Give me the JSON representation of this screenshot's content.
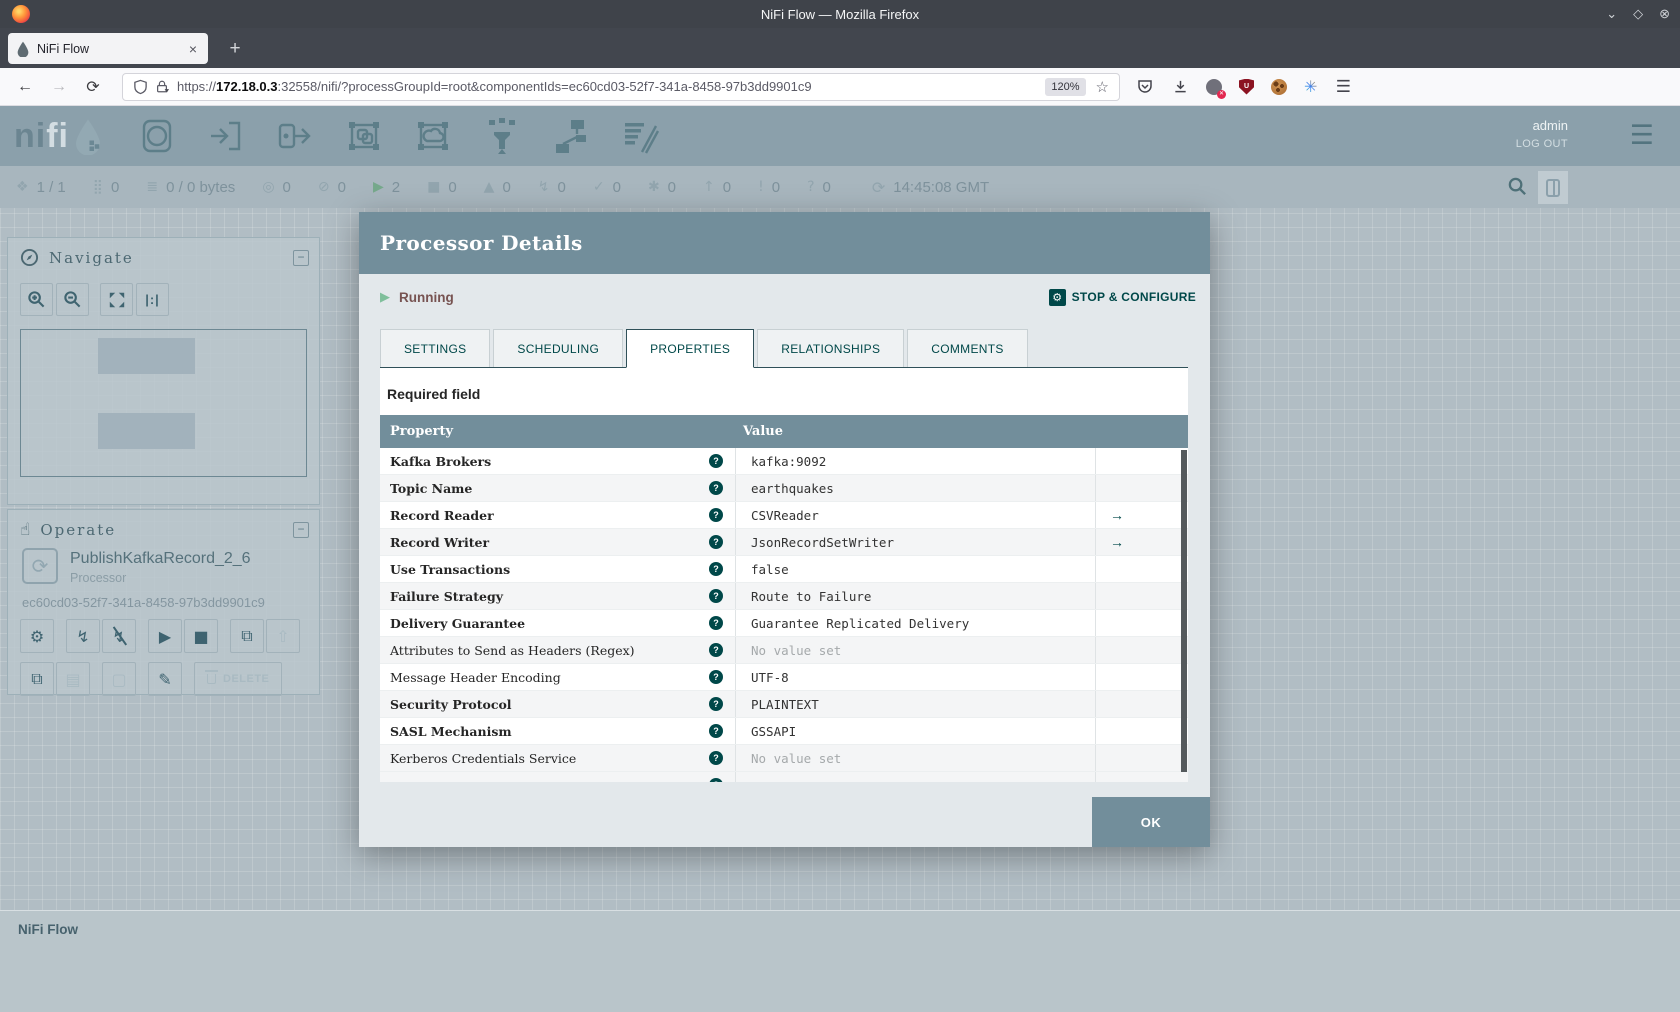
{
  "browser": {
    "window_title": "NiFi Flow — Mozilla Firefox",
    "tab_title": "NiFi Flow",
    "close_tab_label": "×",
    "new_tab_label": "+",
    "url_scheme": "https://",
    "url_host": "172.18.0.3",
    "url_rest": ":32558/nifi/?processGroupId=root&componentIds=ec60cd03-52f7-341a-8458-97b3dd9901c9",
    "zoom_badge": "120%"
  },
  "nifi": {
    "logo_text_left": "ni",
    "logo_text_right": "fi",
    "user": "admin",
    "logout_label": "LOG OUT",
    "status_bar": {
      "items": [
        {
          "icon": "clustered-nodes",
          "value": "1 / 1"
        },
        {
          "icon": "active-threads",
          "value": "0"
        },
        {
          "icon": "queued",
          "value": "0 / 0 bytes"
        },
        {
          "icon": "transmitting",
          "value": "0"
        },
        {
          "icon": "not-transmitting",
          "value": "0"
        },
        {
          "icon": "running",
          "value": "2"
        },
        {
          "icon": "stopped",
          "value": "0"
        },
        {
          "icon": "invalid",
          "value": "0"
        },
        {
          "icon": "disabled",
          "value": "0"
        },
        {
          "icon": "up-to-date",
          "value": "0"
        },
        {
          "icon": "locally-modified",
          "value": "0"
        },
        {
          "icon": "stale",
          "value": "0"
        },
        {
          "icon": "locally-modified-and-stale",
          "value": "0"
        },
        {
          "icon": "sync-failure",
          "value": "0"
        }
      ],
      "last_refreshed": "14:45:08 GMT"
    },
    "navigate_panel": {
      "title": "Navigate"
    },
    "operate_panel": {
      "title": "Operate",
      "component_name": "PublishKafkaRecord_2_6",
      "component_type": "Processor",
      "component_id": "ec60cd03-52f7-341a-8458-97b3dd9901c9",
      "delete_label": "DELETE"
    },
    "breadcrumb": "NiFi Flow"
  },
  "dialog": {
    "title": "Processor Details",
    "status_label": "Running",
    "stop_configure_label": "STOP & CONFIGURE",
    "tabs": [
      "SETTINGS",
      "SCHEDULING",
      "PROPERTIES",
      "RELATIONSHIPS",
      "COMMENTS"
    ],
    "active_tab": "PROPERTIES",
    "required_field_label": "Required field",
    "table": {
      "property_header": "Property",
      "value_header": "Value",
      "rows": [
        {
          "property": "Kafka Brokers",
          "value": "kafka:9092",
          "required": true,
          "unset": false,
          "goto": false
        },
        {
          "property": "Topic Name",
          "value": "earthquakes",
          "required": true,
          "unset": false,
          "goto": false
        },
        {
          "property": "Record Reader",
          "value": "CSVReader",
          "required": true,
          "unset": false,
          "goto": true
        },
        {
          "property": "Record Writer",
          "value": "JsonRecordSetWriter",
          "required": true,
          "unset": false,
          "goto": true
        },
        {
          "property": "Use Transactions",
          "value": "false",
          "required": true,
          "unset": false,
          "goto": false
        },
        {
          "property": "Failure Strategy",
          "value": "Route to Failure",
          "required": true,
          "unset": false,
          "goto": false
        },
        {
          "property": "Delivery Guarantee",
          "value": "Guarantee Replicated Delivery",
          "required": true,
          "unset": false,
          "goto": false
        },
        {
          "property": "Attributes to Send as Headers (Regex)",
          "value": "No value set",
          "required": false,
          "unset": true,
          "goto": false
        },
        {
          "property": "Message Header Encoding",
          "value": "UTF-8",
          "required": false,
          "unset": false,
          "goto": false
        },
        {
          "property": "Security Protocol",
          "value": "PLAINTEXT",
          "required": true,
          "unset": false,
          "goto": false
        },
        {
          "property": "SASL Mechanism",
          "value": "GSSAPI",
          "required": true,
          "unset": false,
          "goto": false
        },
        {
          "property": "Kerberos Credentials Service",
          "value": "No value set",
          "required": false,
          "unset": true,
          "goto": false
        }
      ]
    },
    "ok_label": "OK"
  },
  "colors": {
    "accent": "#004849",
    "dialog_header": "#728E9B",
    "running_green": "#7DC7A0",
    "running_text": "#775351"
  }
}
